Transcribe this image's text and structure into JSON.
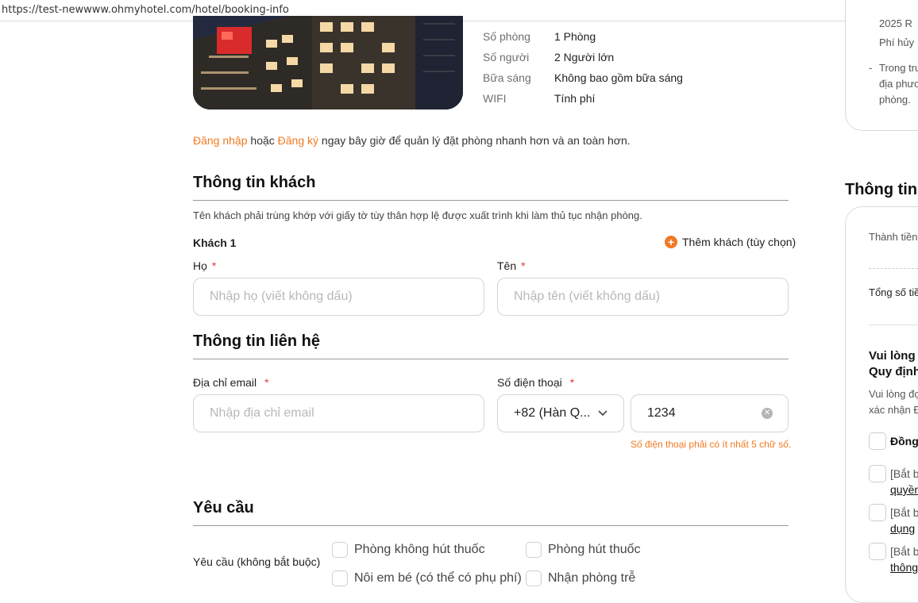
{
  "browser": {
    "url": "https://test-newwww.ohmyhotel.com/hotel/booking-info"
  },
  "summary": {
    "rooms_label": "Số phòng",
    "rooms_value": "1 Phòng",
    "guests_label": "Số người",
    "guests_value": "2 Người lớn",
    "breakfast_label": "Bữa sáng",
    "breakfast_value": "Không bao gồm bữa sáng",
    "wifi_label": "WIFI",
    "wifi_value": "Tính phí"
  },
  "login_prompt": {
    "login_link": "Đăng nhập",
    "or_text": " hoặc ",
    "register_link": "Đăng ký",
    "rest_text": " ngay bây giờ để quản lý đặt phòng nhanh hơn và an toàn hơn."
  },
  "guest_info": {
    "title": "Thông tin khách",
    "note": "Tên khách phải trùng khớp với giấy tờ tùy thân hợp lệ được xuất trình khi làm thủ tục nhận phòng.",
    "guest_label": "Khách 1",
    "add_guest": "Thêm khách (tùy chọn)",
    "last_name_label": "Họ",
    "last_name_placeholder": "Nhập họ (viết không dấu)",
    "first_name_label": "Tên",
    "first_name_placeholder": "Nhập tên (viết không dấu)",
    "required_mark": "*"
  },
  "contact_info": {
    "title": "Thông tin liên hệ",
    "email_label": "Địa chỉ email",
    "email_placeholder": "Nhập địa chỉ email",
    "phone_label": "Số điện thoại",
    "country_code": "+82 (Hàn Q...",
    "phone_value": "1234",
    "phone_error": "Số điện thoại phải có ít nhất 5 chữ số.",
    "required_mark": "*"
  },
  "requests": {
    "title": "Yêu cầu",
    "label": "Yêu cầu (không bắt buộc)",
    "options": [
      "Phòng không hút thuốc",
      "Phòng hút thuốc",
      "Nôi em bé (có thể có phụ phí)",
      "Nhận phòng trễ"
    ]
  },
  "right_panel": {
    "policy_lines": [
      "2025  R",
      "Phí hủy :",
      "-",
      "Trong tru",
      "địa phươ",
      "phòng."
    ],
    "price_title": "Thông tin t",
    "subtotal_label": "Thành tiền",
    "total_label": "Tổng số tiề",
    "agree_heading_1": "Vui lòng l",
    "agree_heading_2": "Quy định",
    "agree_note_1": "Vui lòng đọ",
    "agree_note_2": "xác nhận Đ",
    "agree_all": "Đồng",
    "items": [
      {
        "line1": "[Bắt b",
        "line2": "quyền"
      },
      {
        "line1": "[Bắt b",
        "line2": "dụng"
      },
      {
        "line1": "[Bắt b",
        "line2": "thông"
      }
    ]
  },
  "colors": {
    "accent": "#f07a22",
    "required": "#e53935",
    "border": "#d4d4d4"
  }
}
